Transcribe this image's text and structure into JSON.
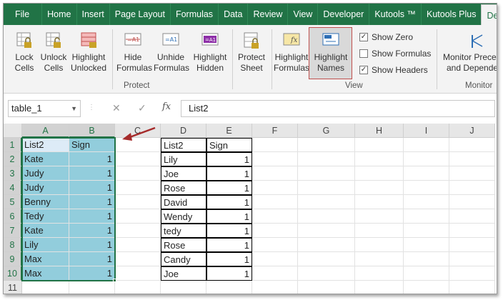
{
  "ribbon_tabs": [
    "File",
    "Home",
    "Insert",
    "Page Layout",
    "Formulas",
    "Data",
    "Review",
    "View",
    "Developer",
    "Kutools ™",
    "Kutools Plus",
    "Design"
  ],
  "active_tab": "Design",
  "ribbon": {
    "lock_cells": [
      "Lock",
      "Cells"
    ],
    "unlock_cells": [
      "Unlock",
      "Cells"
    ],
    "highlight_unlocked": [
      "Highlight",
      "Unlocked"
    ],
    "hide_formulas": [
      "Hide",
      "Formulas"
    ],
    "unhide_formulas": [
      "Unhide",
      "Formulas"
    ],
    "highlight_hidden": [
      "Highlight",
      "Hidden"
    ],
    "protect_sheet": [
      "Protect",
      "Sheet"
    ],
    "highlight_formulas": [
      "Highlight",
      "Formulas"
    ],
    "highlight_names": [
      "Highlight",
      "Names"
    ],
    "monitor": [
      "Monitor Prece",
      "and Depende"
    ],
    "group_protect": "Protect",
    "group_view": "View",
    "group_monitor": "Monitor",
    "show_zero": "Show Zero",
    "show_formulas": "Show Formulas",
    "show_headers": "Show Headers",
    "show_zero_checked": true,
    "show_formulas_checked": false,
    "show_headers_checked": true
  },
  "formula_bar": {
    "name_box": "table_1",
    "cancel_symbol": "✕",
    "enter_symbol": "✓",
    "fx_symbol": "fx",
    "content": "List2"
  },
  "columns": [
    "A",
    "B",
    "C",
    "D",
    "E",
    "F",
    "G",
    "H",
    "I",
    "J"
  ],
  "rows": [
    "1",
    "2",
    "3",
    "4",
    "5",
    "6",
    "7",
    "8",
    "9",
    "10",
    "11"
  ],
  "table1": {
    "headers": [
      "List2",
      "Sign"
    ],
    "names": [
      "Kate",
      "Judy",
      "Judy",
      "Benny",
      "Tedy",
      "Kate",
      "Lily",
      "Max",
      "Max"
    ],
    "signs": [
      "1",
      "1",
      "1",
      "1",
      "1",
      "1",
      "1",
      "1",
      "1"
    ]
  },
  "table2": {
    "headers": [
      "List2",
      "Sign"
    ],
    "names": [
      "Lily",
      "Joe",
      "Rose",
      "David",
      "Wendy",
      "tedy",
      "Rose",
      "Candy",
      "Joe"
    ],
    "signs": [
      "1",
      "1",
      "1",
      "1",
      "1",
      "1",
      "1",
      "1",
      "1"
    ]
  },
  "colors": {
    "excel_green": "#217346",
    "highlight_teal": "#92cddc",
    "arrow_red": "#c0504d"
  }
}
